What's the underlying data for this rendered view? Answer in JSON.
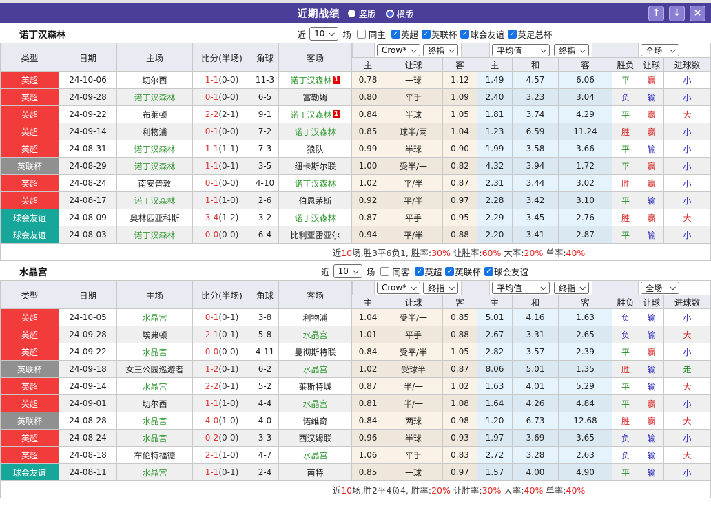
{
  "titlebar": {
    "title": "近期战绩",
    "radio_vertical": "竖版",
    "radio_horizontal": "横版",
    "buttons": {
      "up": "↑",
      "down": "↓",
      "close": "×"
    }
  },
  "labels": {
    "near": "近",
    "games_unit": "场"
  },
  "dropdowns": {
    "bookmaker": "Crow*",
    "final": "终指",
    "average": "平均值",
    "fulltime": "全场"
  },
  "columns": {
    "type": "类型",
    "date": "日期",
    "home": "主场",
    "score": "比分(半场)",
    "corner": "角球",
    "away": "客场",
    "ah_home": "主",
    "ah_line": "让球",
    "ah_away": "客",
    "eu_home": "主",
    "eu_draw": "和",
    "eu_away": "客",
    "res_wdl": "胜负",
    "res_ah": "让球",
    "res_ou": "进球数"
  },
  "colors": {
    "titlebar": "#4B3E99",
    "league_epl": "#F23C3C",
    "league_league_cup": "#909090",
    "league_friendly": "#17A79A",
    "focus_team": "#339933",
    "score_red": "#E03333",
    "result_red": "#D42A2A",
    "result_green": "#1F8B1F",
    "result_blue": "#3333BB"
  },
  "sections": [
    {
      "team": "诺丁汉森林",
      "filters": {
        "games": "10",
        "same_label": "同主",
        "same_checked": false,
        "leagues": [
          "英超",
          "英联杯",
          "球会友谊",
          "英足总杯"
        ]
      },
      "rows": [
        {
          "type": "英超",
          "date": "24-10-06",
          "home": "切尔西",
          "hf": false,
          "score": "1-1",
          "half": "(0-0)",
          "corner": "11-3",
          "away": "诺丁汉森林",
          "af": true,
          "badge": "1",
          "ah": [
            "0.78",
            "一球",
            "1.12"
          ],
          "eu": [
            "1.49",
            "4.57",
            "6.06"
          ],
          "res": [
            "平",
            "赢",
            "小"
          ]
        },
        {
          "type": "英超",
          "date": "24-09-28",
          "home": "诺丁汉森林",
          "hf": true,
          "score": "0-1",
          "half": "(0-0)",
          "corner": "6-5",
          "away": "富勒姆",
          "af": false,
          "ah": [
            "0.80",
            "平手",
            "1.09"
          ],
          "eu": [
            "2.40",
            "3.23",
            "3.04"
          ],
          "res": [
            "负",
            "输",
            "小"
          ]
        },
        {
          "type": "英超",
          "date": "24-09-22",
          "home": "布莱顿",
          "hf": false,
          "score": "2-2",
          "half": "(2-1)",
          "corner": "9-1",
          "away": "诺丁汉森林",
          "af": true,
          "badge": "1",
          "ah": [
            "0.84",
            "半球",
            "1.05"
          ],
          "eu": [
            "1.81",
            "3.74",
            "4.29"
          ],
          "res": [
            "平",
            "赢",
            "大"
          ]
        },
        {
          "type": "英超",
          "date": "24-09-14",
          "home": "利物浦",
          "hf": false,
          "score": "0-1",
          "half": "(0-0)",
          "corner": "7-2",
          "away": "诺丁汉森林",
          "af": true,
          "ah": [
            "0.85",
            "球半/两",
            "1.04"
          ],
          "eu": [
            "1.23",
            "6.59",
            "11.24"
          ],
          "res": [
            "胜",
            "赢",
            "小"
          ]
        },
        {
          "type": "英超",
          "date": "24-08-31",
          "home": "诺丁汉森林",
          "hf": true,
          "score": "1-1",
          "half": "(1-1)",
          "corner": "7-3",
          "away": "狼队",
          "af": false,
          "ah": [
            "0.99",
            "半球",
            "0.90"
          ],
          "eu": [
            "1.99",
            "3.58",
            "3.66"
          ],
          "res": [
            "平",
            "输",
            "小"
          ]
        },
        {
          "type": "英联杯",
          "date": "24-08-29",
          "home": "诺丁汉森林",
          "hf": true,
          "score": "1-1",
          "half": "(0-1)",
          "corner": "3-5",
          "away": "纽卡斯尔联",
          "af": false,
          "ah": [
            "1.00",
            "受半/一",
            "0.82"
          ],
          "eu": [
            "4.32",
            "3.94",
            "1.72"
          ],
          "res": [
            "平",
            "赢",
            "小"
          ]
        },
        {
          "type": "英超",
          "date": "24-08-24",
          "home": "南安普敦",
          "hf": false,
          "score": "0-1",
          "half": "(0-0)",
          "corner": "4-10",
          "away": "诺丁汉森林",
          "af": true,
          "ah": [
            "1.02",
            "平/半",
            "0.87"
          ],
          "eu": [
            "2.31",
            "3.44",
            "3.02"
          ],
          "res": [
            "胜",
            "赢",
            "小"
          ]
        },
        {
          "type": "英超",
          "date": "24-08-17",
          "home": "诺丁汉森林",
          "hf": true,
          "score": "1-1",
          "half": "(1-0)",
          "corner": "2-6",
          "away": "伯恩茅斯",
          "af": false,
          "ah": [
            "0.92",
            "平/半",
            "0.97"
          ],
          "eu": [
            "2.28",
            "3.42",
            "3.10"
          ],
          "res": [
            "平",
            "输",
            "小"
          ]
        },
        {
          "type": "球会友谊",
          "date": "24-08-09",
          "home": "奥林匹亚科斯",
          "hf": false,
          "score": "3-4",
          "half": "(1-2)",
          "corner": "3-2",
          "away": "诺丁汉森林",
          "af": true,
          "ah": [
            "0.87",
            "平手",
            "0.95"
          ],
          "eu": [
            "2.29",
            "3.45",
            "2.76"
          ],
          "res": [
            "胜",
            "赢",
            "大"
          ]
        },
        {
          "type": "球会友谊",
          "date": "24-08-03",
          "home": "诺丁汉森林",
          "hf": true,
          "score": "0-0",
          "half": "(0-0)",
          "corner": "6-4",
          "away": "比利亚雷亚尔",
          "af": false,
          "ah": [
            "0.94",
            "平/半",
            "0.88"
          ],
          "eu": [
            "2.20",
            "3.41",
            "2.87"
          ],
          "res": [
            "平",
            "输",
            "小"
          ]
        }
      ],
      "summary": [
        {
          "t": "近",
          "c": "d"
        },
        {
          "t": "10",
          "c": "r"
        },
        {
          "t": "场,胜3平6负1, 胜率:",
          "c": "d"
        },
        {
          "t": "30%",
          "c": "r"
        },
        {
          "t": " 让胜率:",
          "c": "d"
        },
        {
          "t": "60%",
          "c": "r"
        },
        {
          "t": " 大率:",
          "c": "d"
        },
        {
          "t": "20%",
          "c": "r"
        },
        {
          "t": " 单率:",
          "c": "d"
        },
        {
          "t": "40%",
          "c": "r"
        }
      ]
    },
    {
      "team": "水晶宫",
      "filters": {
        "games": "10",
        "same_label": "同客",
        "same_checked": false,
        "leagues": [
          "英超",
          "英联杯",
          "球会友谊"
        ]
      },
      "rows": [
        {
          "type": "英超",
          "date": "24-10-05",
          "home": "水晶宫",
          "hf": true,
          "score": "0-1",
          "half": "(0-1)",
          "corner": "3-8",
          "away": "利物浦",
          "af": false,
          "ah": [
            "1.04",
            "受半/一",
            "0.85"
          ],
          "eu": [
            "5.01",
            "4.16",
            "1.63"
          ],
          "res": [
            "负",
            "输",
            "小"
          ]
        },
        {
          "type": "英超",
          "date": "24-09-28",
          "home": "埃弗顿",
          "hf": false,
          "score": "2-1",
          "half": "(0-1)",
          "corner": "5-8",
          "away": "水晶宫",
          "af": true,
          "ah": [
            "1.01",
            "平手",
            "0.88"
          ],
          "eu": [
            "2.67",
            "3.31",
            "2.65"
          ],
          "res": [
            "负",
            "输",
            "大"
          ]
        },
        {
          "type": "英超",
          "date": "24-09-22",
          "home": "水晶宫",
          "hf": true,
          "score": "0-0",
          "half": "(0-0)",
          "corner": "4-11",
          "away": "曼彻斯特联",
          "af": false,
          "ah": [
            "0.84",
            "受平/半",
            "1.05"
          ],
          "eu": [
            "2.82",
            "3.57",
            "2.39"
          ],
          "res": [
            "平",
            "赢",
            "小"
          ]
        },
        {
          "type": "英联杯",
          "date": "24-09-18",
          "home": "女王公园巡游者",
          "hf": false,
          "score": "1-2",
          "half": "(0-1)",
          "corner": "6-2",
          "away": "水晶宫",
          "af": true,
          "ah": [
            "1.02",
            "受球半",
            "0.87"
          ],
          "eu": [
            "8.06",
            "5.01",
            "1.35"
          ],
          "res": [
            "胜",
            "输",
            "走"
          ]
        },
        {
          "type": "英超",
          "date": "24-09-14",
          "home": "水晶宫",
          "hf": true,
          "score": "2-2",
          "half": "(0-1)",
          "corner": "5-2",
          "away": "莱斯特城",
          "af": false,
          "ah": [
            "0.87",
            "半/一",
            "1.02"
          ],
          "eu": [
            "1.63",
            "4.01",
            "5.29"
          ],
          "res": [
            "平",
            "输",
            "大"
          ]
        },
        {
          "type": "英超",
          "date": "24-09-01",
          "home": "切尔西",
          "hf": false,
          "score": "1-1",
          "half": "(1-0)",
          "corner": "4-4",
          "away": "水晶宫",
          "af": true,
          "ah": [
            "0.81",
            "半/一",
            "1.08"
          ],
          "eu": [
            "1.64",
            "4.26",
            "4.84"
          ],
          "res": [
            "平",
            "赢",
            "小"
          ]
        },
        {
          "type": "英联杯",
          "date": "24-08-28",
          "home": "水晶宫",
          "hf": true,
          "score": "4-0",
          "half": "(1-0)",
          "corner": "4-0",
          "away": "诺维奇",
          "af": false,
          "ah": [
            "0.84",
            "两球",
            "0.98"
          ],
          "eu": [
            "1.20",
            "6.73",
            "12.68"
          ],
          "res": [
            "胜",
            "赢",
            "大"
          ]
        },
        {
          "type": "英超",
          "date": "24-08-24",
          "home": "水晶宫",
          "hf": true,
          "score": "0-2",
          "half": "(0-0)",
          "corner": "3-3",
          "away": "西汉姆联",
          "af": false,
          "ah": [
            "0.96",
            "半球",
            "0.93"
          ],
          "eu": [
            "1.97",
            "3.69",
            "3.65"
          ],
          "res": [
            "负",
            "输",
            "小"
          ]
        },
        {
          "type": "英超",
          "date": "24-08-18",
          "home": "布伦特福德",
          "hf": false,
          "score": "2-1",
          "half": "(1-0)",
          "corner": "4-7",
          "away": "水晶宫",
          "af": true,
          "ah": [
            "1.06",
            "平手",
            "0.83"
          ],
          "eu": [
            "2.72",
            "3.28",
            "2.63"
          ],
          "res": [
            "负",
            "输",
            "大"
          ]
        },
        {
          "type": "球会友谊",
          "date": "24-08-11",
          "home": "水晶宫",
          "hf": true,
          "score": "1-1",
          "half": "(0-1)",
          "corner": "2-4",
          "away": "南特",
          "af": false,
          "ah": [
            "0.85",
            "一球",
            "0.97"
          ],
          "eu": [
            "1.57",
            "4.00",
            "4.90"
          ],
          "res": [
            "平",
            "输",
            "小"
          ]
        }
      ],
      "summary": [
        {
          "t": "近",
          "c": "d"
        },
        {
          "t": "10",
          "c": "r"
        },
        {
          "t": "场,胜2平4负4, 胜率:",
          "c": "d"
        },
        {
          "t": "20%",
          "c": "r"
        },
        {
          "t": " 让胜率:",
          "c": "d"
        },
        {
          "t": "30%",
          "c": "r"
        },
        {
          "t": " 大率:",
          "c": "d"
        },
        {
          "t": "40%",
          "c": "r"
        },
        {
          "t": " 单率:",
          "c": "d"
        },
        {
          "t": "40%",
          "c": "r"
        }
      ]
    }
  ]
}
